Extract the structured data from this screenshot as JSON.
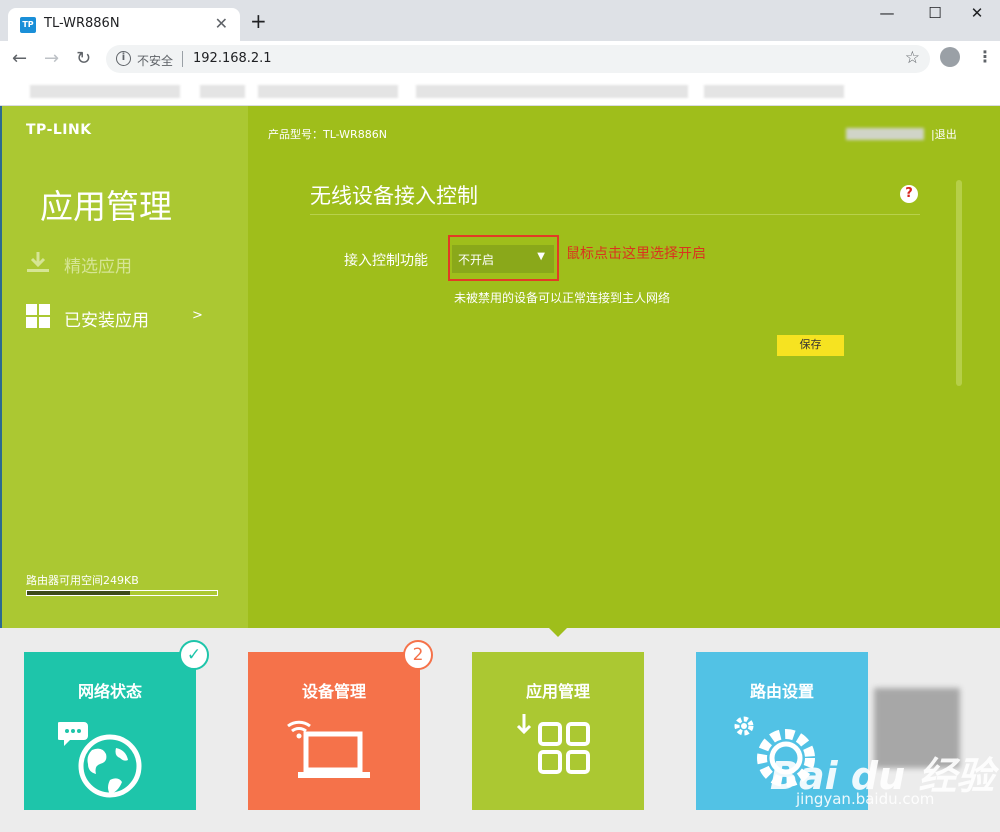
{
  "browser": {
    "tab_title": "TL-WR886N",
    "favicon_text": "TP",
    "security_label": "不安全",
    "url": "192.168.2.1"
  },
  "router": {
    "brand": "TP-LINK",
    "model_label": "产品型号：TL-WR886N",
    "logout": "|退出",
    "sidebar": {
      "title": "应用管理",
      "items": [
        {
          "label": "精选应用",
          "icon": "download-icon"
        },
        {
          "label": "已安装应用",
          "icon": "grid-icon",
          "chevron": ">"
        }
      ],
      "space_label": "路由器可用空间249KB",
      "space_fraction": 0.54
    },
    "panel": {
      "title": "无线设备接入控制",
      "help_symbol": "?",
      "field_label": "接入控制功能",
      "select_value": "不开启",
      "annotation": "鼠标点击这里选择开启",
      "hint": "未被禁用的设备可以正常连接到主人网络",
      "save_label": "保存"
    }
  },
  "tiles": [
    {
      "label": "网络状态",
      "color": "#1ec5aa",
      "badge": "✓"
    },
    {
      "label": "设备管理",
      "color": "#f5724a",
      "badge": "2"
    },
    {
      "label": "应用管理",
      "color": "#abc832"
    },
    {
      "label": "路由设置",
      "color": "#52c2e5"
    }
  ],
  "watermark": {
    "logo_text": "Bai du 经验",
    "url": "jingyan.baidu.com"
  },
  "colors": {
    "sidebar": "#abc832",
    "main": "#9fbe1b",
    "annotation": "#d9341f",
    "save_button": "#f6e321"
  }
}
